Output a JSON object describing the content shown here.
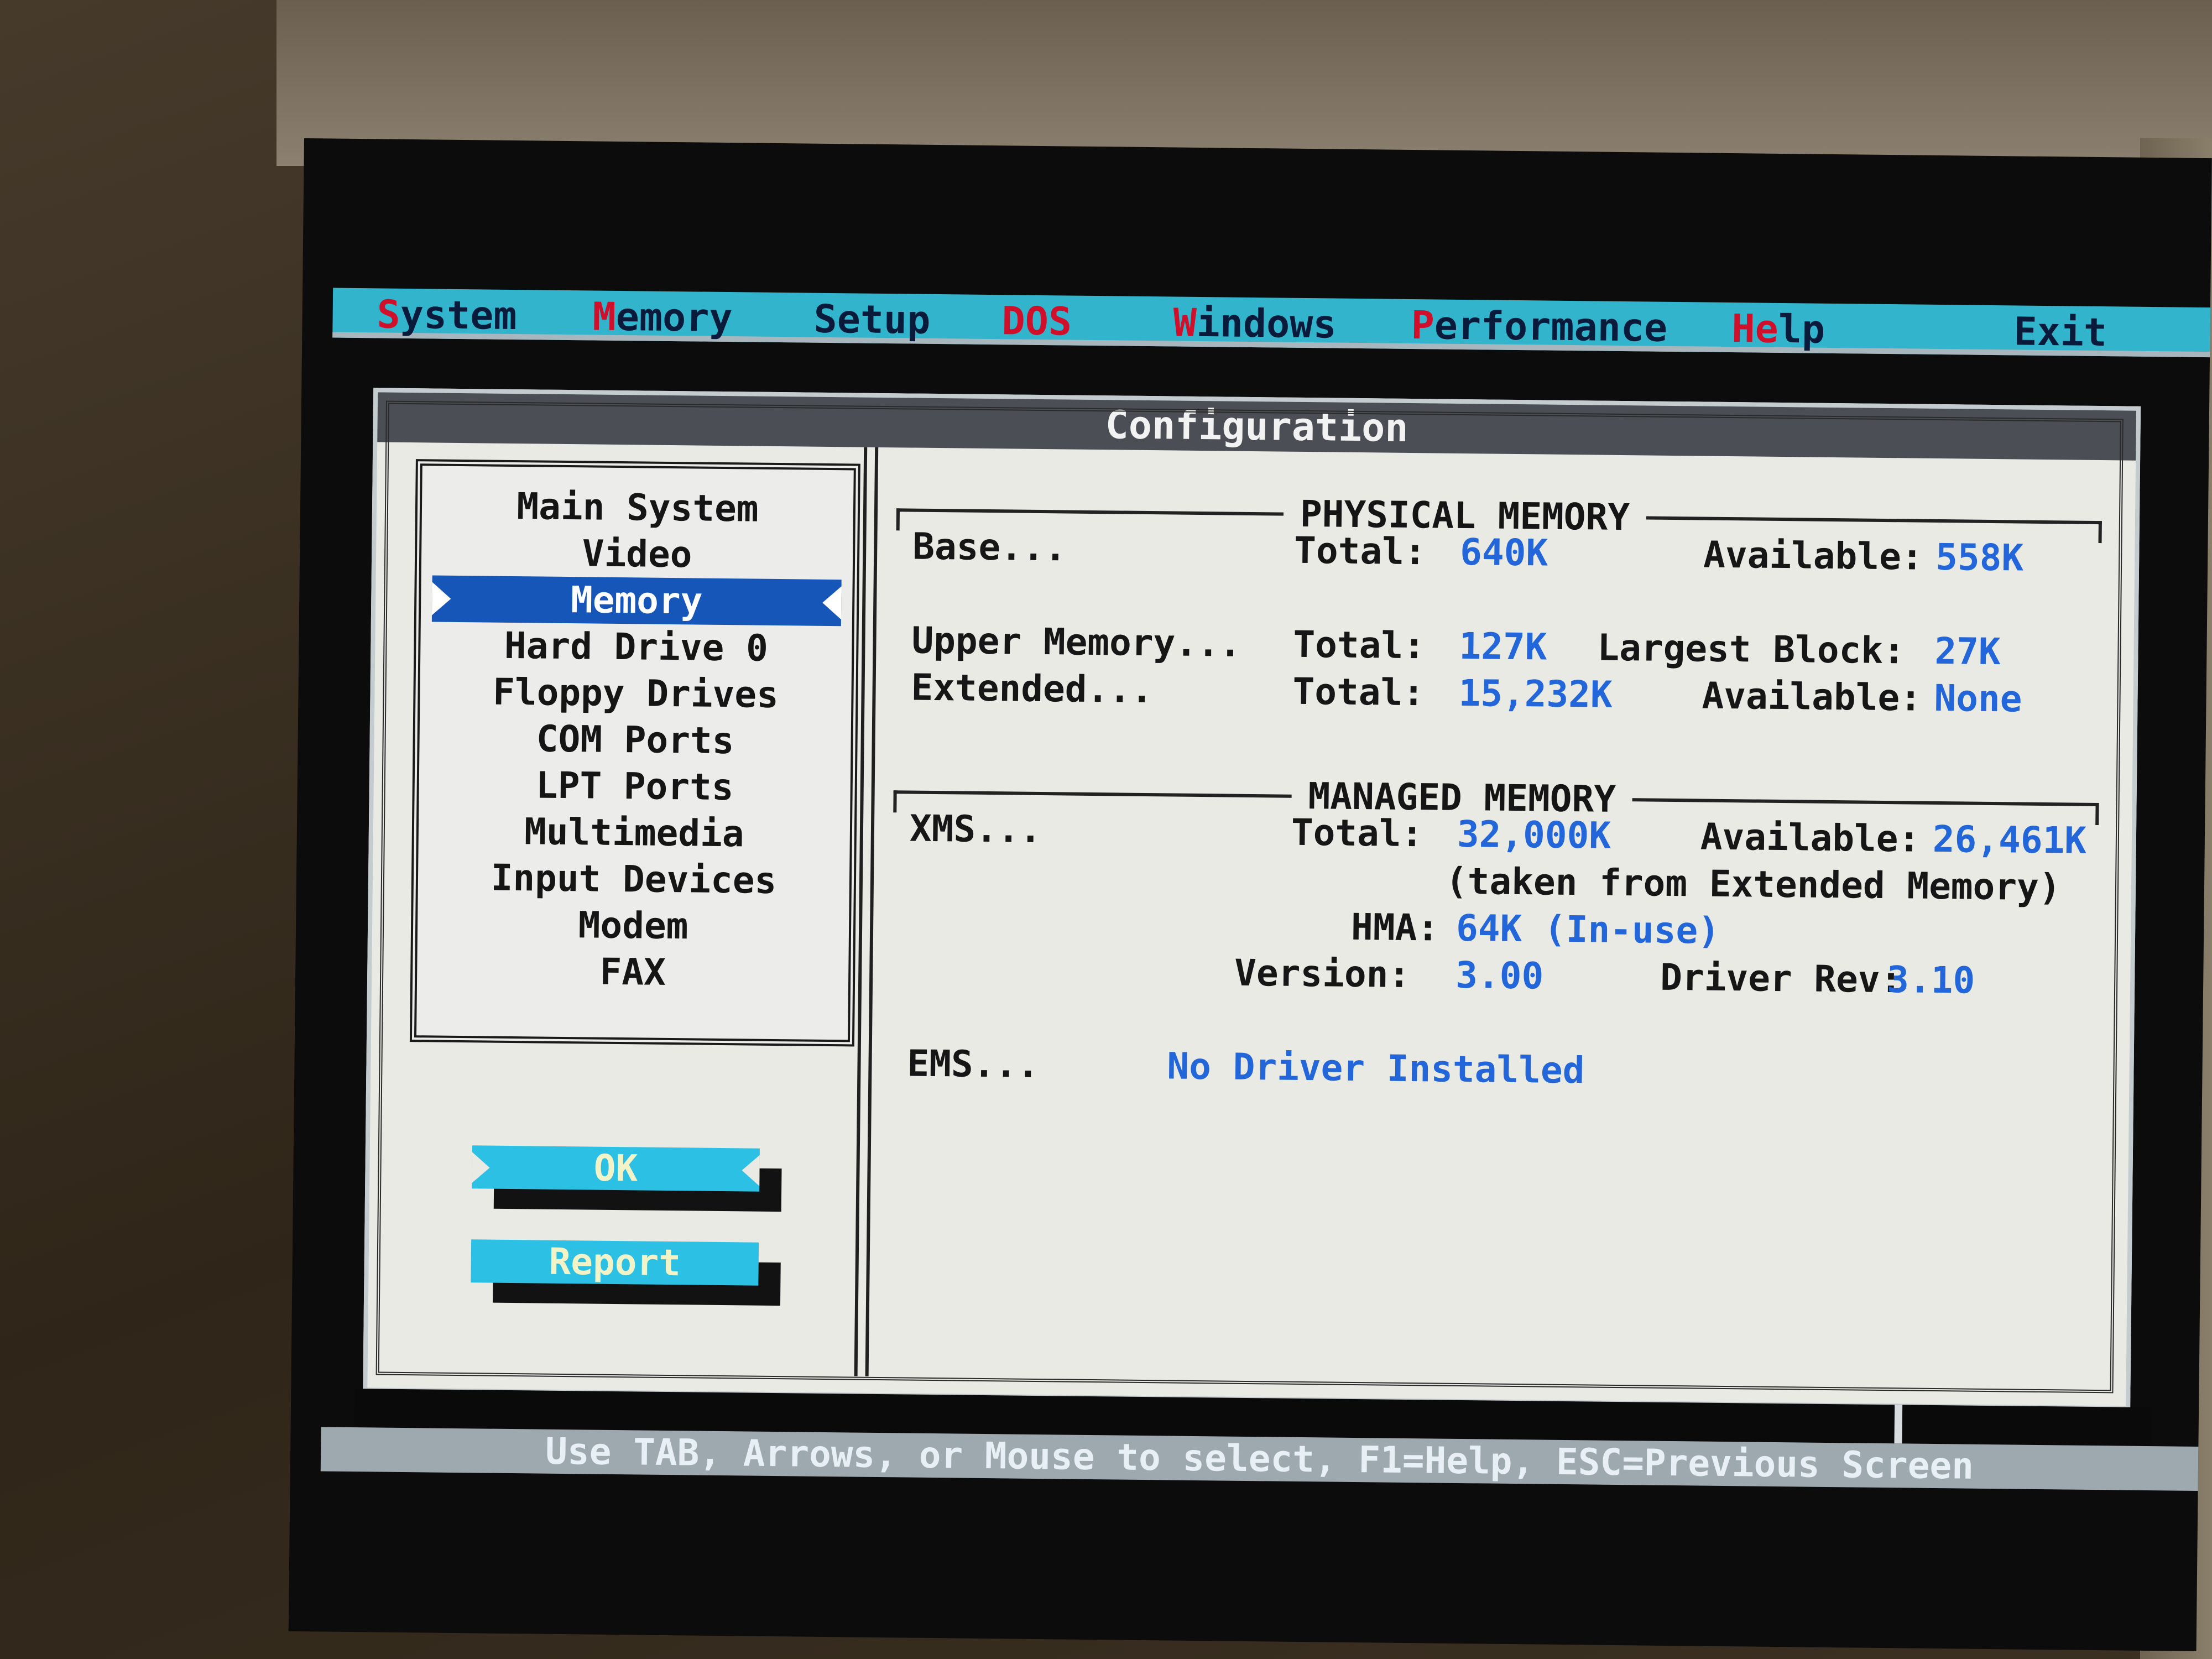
{
  "menu": {
    "items": [
      {
        "hot": "S",
        "rest": "ystem"
      },
      {
        "hot": "M",
        "rest": "emory"
      },
      {
        "hot": "",
        "rest": "Setup"
      },
      {
        "hot": "DOS",
        "rest": ""
      },
      {
        "hot": "W",
        "rest": "indows"
      },
      {
        "hot": "P",
        "rest": "erformance"
      },
      {
        "hot": "He",
        "rest": "lp"
      },
      {
        "hot": "",
        "rest": "Exit"
      }
    ]
  },
  "dialog": {
    "title": "Configuration",
    "categories": [
      "Main System",
      "Video",
      "Memory",
      "Hard Drive 0",
      "Floppy Drives",
      "COM Ports",
      "LPT Ports",
      "Multimedia",
      "Input Devices",
      "Modem",
      "FAX"
    ],
    "selected_category": "Memory",
    "buttons": {
      "ok": "OK",
      "report": "Report"
    }
  },
  "physical_memory": {
    "heading": "PHYSICAL MEMORY",
    "base_label": "Base...",
    "base_total_label": "Total:",
    "base_total": "640K",
    "base_available_label": "Available:",
    "base_available": "558K",
    "upper_label": "Upper Memory...",
    "upper_total_label": "Total:",
    "upper_total": "127K",
    "upper_largest_label": "Largest Block:",
    "upper_largest": "27K",
    "extended_label": "Extended...",
    "extended_total_label": "Total:",
    "extended_total": "15,232K",
    "extended_available_label": "Available:",
    "extended_available": "None"
  },
  "managed_memory": {
    "heading": "MANAGED MEMORY",
    "xms_label": "XMS...",
    "xms_total_label": "Total:",
    "xms_total": "32,000K",
    "xms_available_label": "Available:",
    "xms_available": "26,461K",
    "xms_note": "(taken from Extended Memory)",
    "hma_label": "HMA:",
    "hma_value": "64K (In-use)",
    "version_label": "Version:",
    "version_value": "3.00",
    "driver_rev_label": "Driver Rev:",
    "driver_rev_value": "3.10",
    "ems_label": "EMS...",
    "ems_value": "No Driver Installed"
  },
  "status_bar": {
    "text": "Use TAB, Arrows, or Mouse to select, F1=Help, ESC=Previous Screen"
  },
  "colors": {
    "menubar": "#32b5cc",
    "hotkey": "#d0102a",
    "value_text": "#2266d9",
    "selection": "#1556b8",
    "button": "#2cc0e4",
    "dialog_bg": "#e9eae4"
  }
}
